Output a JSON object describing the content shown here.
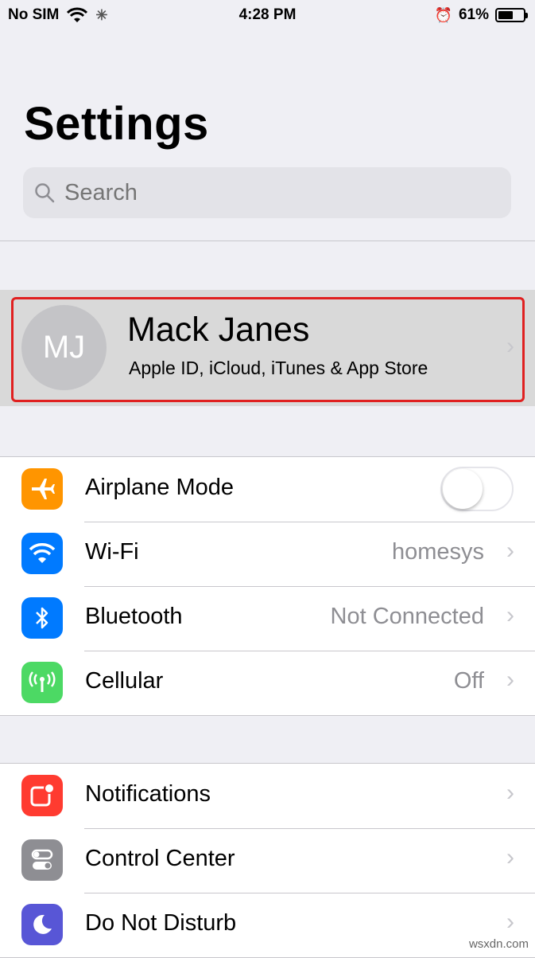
{
  "status_bar": {
    "carrier": "No SIM",
    "time": "4:28 PM",
    "battery_percent": "61%",
    "battery_level": 0.61
  },
  "page_title": "Settings",
  "search": {
    "placeholder": "Search"
  },
  "profile": {
    "initials": "MJ",
    "name": "Mack Janes",
    "subtitle": "Apple ID, iCloud, iTunes & App Store"
  },
  "group1": [
    {
      "label": "Airplane Mode",
      "value": "",
      "icon": "airplane-icon",
      "color": "#ff9500",
      "toggle": false
    },
    {
      "label": "Wi-Fi",
      "value": "homesys",
      "icon": "wifi-icon",
      "color": "#007aff"
    },
    {
      "label": "Bluetooth",
      "value": "Not Connected",
      "icon": "bluetooth-icon",
      "color": "#007aff"
    },
    {
      "label": "Cellular",
      "value": "Off",
      "icon": "cellular-icon",
      "color": "#4cd964"
    }
  ],
  "group2": [
    {
      "label": "Notifications",
      "icon": "notifications-icon",
      "color": "#ff3b30"
    },
    {
      "label": "Control Center",
      "icon": "control-center-icon",
      "color": "#8e8e93"
    },
    {
      "label": "Do Not Disturb",
      "icon": "moon-icon",
      "color": "#5856d6"
    }
  ],
  "watermark": "wsxdn.com"
}
